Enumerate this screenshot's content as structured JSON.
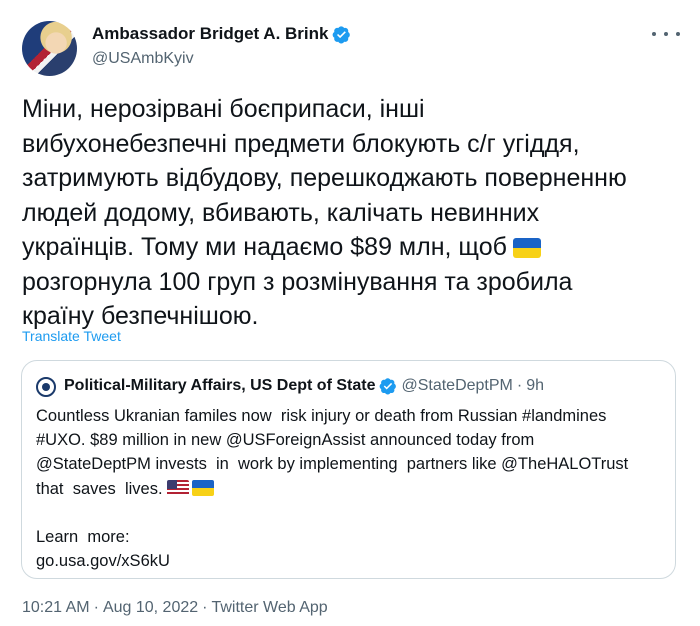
{
  "author": {
    "name": "Ambassador Bridget A. Brink",
    "handle": "@USAmbKyiv"
  },
  "tweet": {
    "text": "Міни, нерозірвані боєприпаси, інші\nвибухонебезпечні предмети блокують с/г угіддя,\nзатримують відбудову, перешкоджають поверненню\nлюдей додому, вбивають, калічать невинних\nукраїнців. Тому ми надаємо $89 млн, щоб",
    "text_tail": "розгорнула 100 груп з розмінування та зробила\nкраїну безпечнішою.",
    "flag_icon": "flag-ukraine"
  },
  "translate_label": "Translate Tweet",
  "quote": {
    "name": "Political-Military Affairs, US Dept of State",
    "handle": "@StateDeptPM",
    "dot": "·",
    "time": "9h",
    "lines": [
      "Countless Ukranian familes now  risk injury or death from Russian #landmines",
      "#UXO. $89 million in new @USForeignAssist announced today from",
      "@StateDeptPM invests  in  work by implementing  partners like @TheHALOTrust",
      "that  saves  lives."
    ],
    "learn_more": "Learn  more:",
    "link": "go.usa.gov/xS6kU",
    "flag_icons": [
      "flag-united-states",
      "flag-ukraine"
    ]
  },
  "meta": {
    "time": "10:21 AM",
    "date": "Aug 10, 2022",
    "source": "Twitter Web App",
    "sep": "·"
  },
  "colors": {
    "accent": "#1d9bf0",
    "secondary_text": "#536471",
    "border": "#cfd9de"
  }
}
